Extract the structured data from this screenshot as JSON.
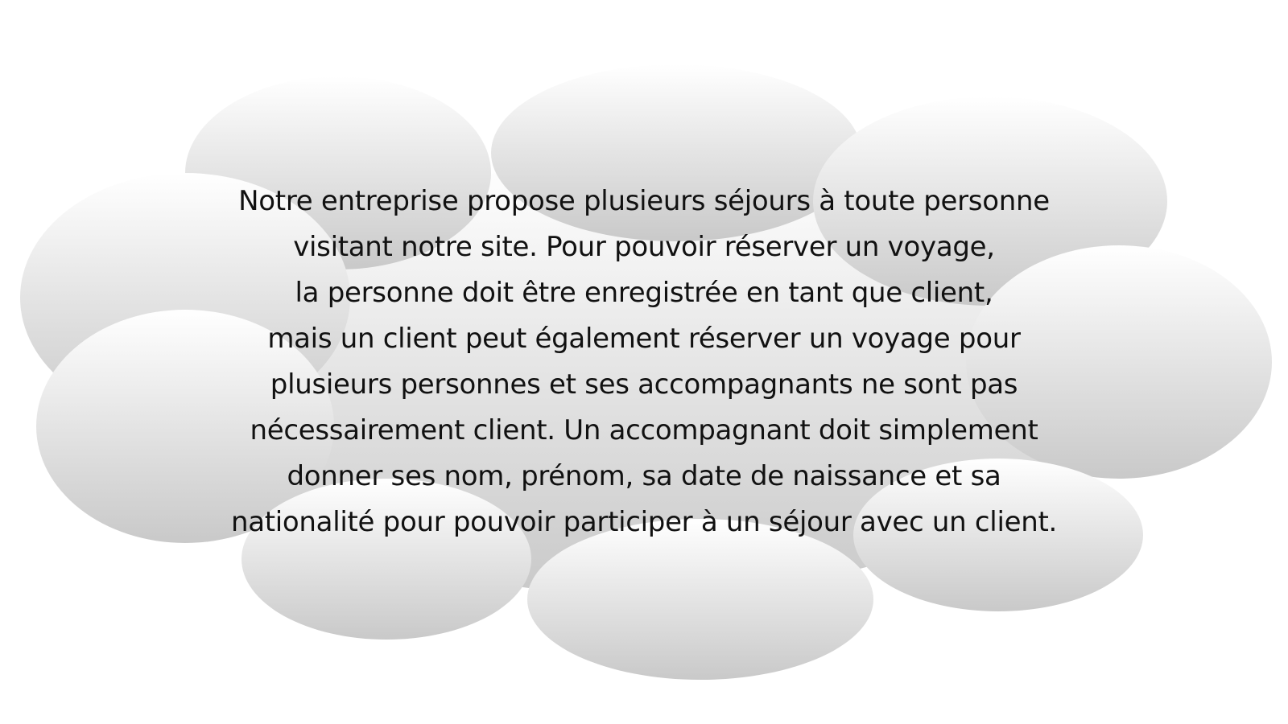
{
  "cloud": {
    "fill_top": "#ffffff",
    "fill_bottom": "#c9c9c9",
    "lines": [
      "Notre entreprise propose plusieurs séjours à toute personne",
      "visitant notre site. Pour pouvoir réserver un voyage,",
      "la personne doit être enregistrée en tant que client,",
      "mais un client peut également réserver un voyage pour",
      "plusieurs personnes et ses accompagnants ne sont pas",
      "nécessairement client. Un accompagnant doit simplement",
      "donner ses nom, prénom, sa date de naissance et sa",
      "nationalité pour pouvoir participer à un séjour avec un client."
    ]
  }
}
